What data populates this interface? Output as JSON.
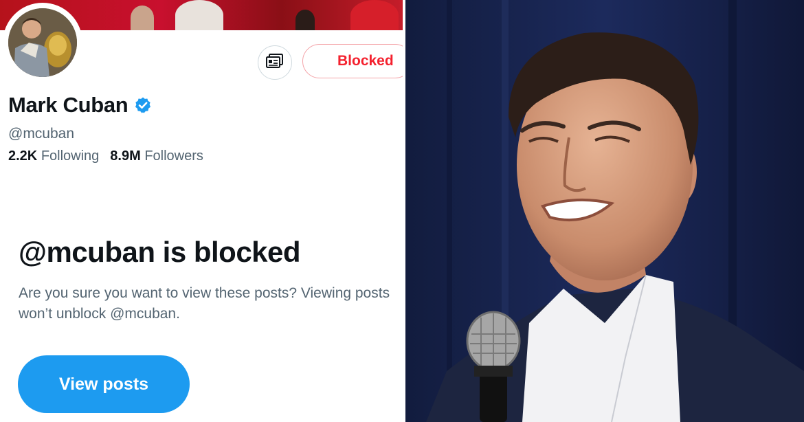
{
  "profile": {
    "name": "Mark Cuban",
    "handle": "@mcuban",
    "following_count": "2.2K",
    "following_label": "Following",
    "followers_count": "8.9M",
    "followers_label": "Followers",
    "blocked_label": "Blocked",
    "verified": true
  },
  "blocked_notice": {
    "title": "@mcuban is blocked",
    "description": "Are you sure you want to view these posts? Viewing posts won’t unblock @mcuban.",
    "button_label": "View posts"
  },
  "icons": {
    "more_button": "feed-icon",
    "verified_badge": "verified-badge-icon"
  },
  "colors": {
    "blocked_red": "#f4212e",
    "accent_blue": "#1d9bf0",
    "text_primary": "#0f1419",
    "text_secondary": "#536471"
  }
}
